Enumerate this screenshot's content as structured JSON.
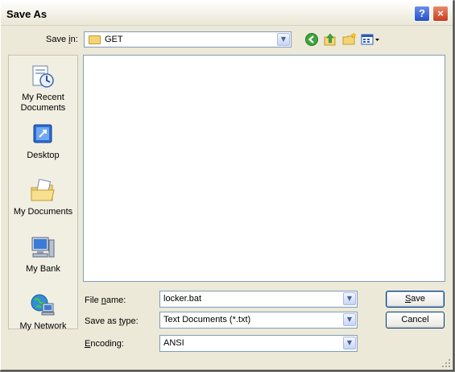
{
  "window": {
    "title": "Save As",
    "help_glyph": "?",
    "close_glyph": "×"
  },
  "toolbar": {
    "save_in_label": "Save in:",
    "save_in_access_key": "i",
    "current_folder": "GET",
    "icons": [
      "back-icon",
      "up-folder-icon",
      "new-folder-icon",
      "views-menu-icon"
    ]
  },
  "places": [
    {
      "label_line1": "My Recent",
      "label_line2": "Documents",
      "icon": "recent-documents-icon"
    },
    {
      "label_line1": "Desktop",
      "label_line2": "",
      "icon": "desktop-icon"
    },
    {
      "label_line1": "My Documents",
      "label_line2": "",
      "icon": "my-documents-icon"
    },
    {
      "label_line1": "My Bank",
      "label_line2": "",
      "icon": "computer-icon"
    },
    {
      "label_line1": "My Network",
      "label_line2": "",
      "icon": "network-icon"
    }
  ],
  "fields": {
    "file_name": {
      "label_pre": "File ",
      "label_key": "n",
      "label_post": "ame:",
      "value": "locker.bat"
    },
    "save_as_type": {
      "label_pre": "Save as ",
      "label_key": "t",
      "label_post": "ype:",
      "value": "Text Documents (*.txt)"
    },
    "encoding": {
      "label_pre": "",
      "label_key": "E",
      "label_post": "ncoding:",
      "value": "ANSI"
    }
  },
  "buttons": {
    "save": {
      "label_key": "S",
      "label_post": "ave"
    },
    "cancel": {
      "label": "Cancel"
    }
  },
  "colors": {
    "dialog_bg": "#ece9d8",
    "field_border": "#7f9db9",
    "close_red": "#c83c1c",
    "help_blue": "#2450c8"
  }
}
